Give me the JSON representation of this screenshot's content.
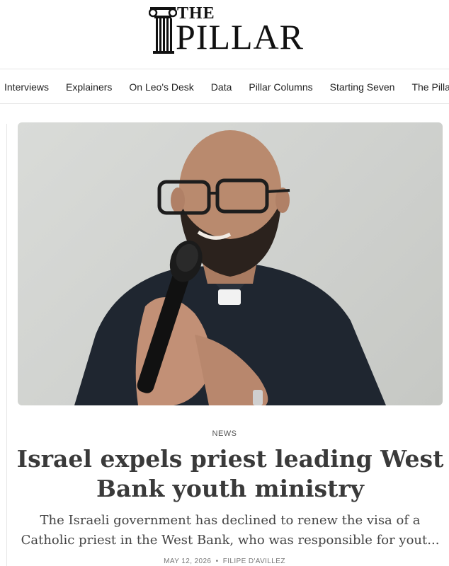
{
  "brand": {
    "logo_the": "THE",
    "logo_pillar": "PILLAR"
  },
  "nav": {
    "items": [
      "Interviews",
      "Explainers",
      "On Leo's Desk",
      "Data",
      "Pillar Columns",
      "Starting Seven",
      "The Pillar Po"
    ]
  },
  "article": {
    "category": "News",
    "headline": "Israel expels priest leading West Bank youth ministry",
    "dek": "The Israeli government has declined to renew the visa of a Catholic priest in the West Bank, who was responsible for yout...",
    "date": "May 12, 2026",
    "separator": "•",
    "author": "Filipe d'Avillez"
  }
}
